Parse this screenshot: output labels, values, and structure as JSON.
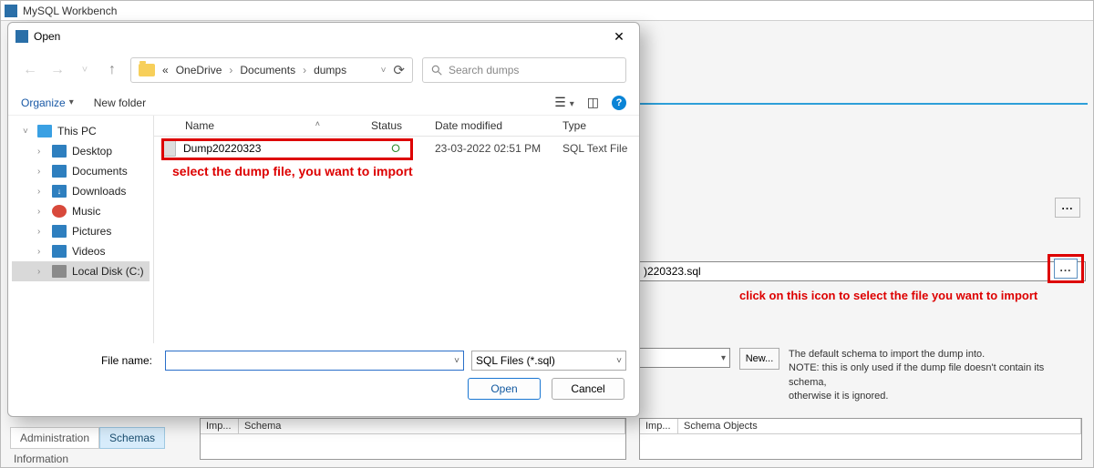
{
  "workbench": {
    "title": "MySQL Workbench",
    "nav_admin": "Administration",
    "nav_schemas": "Schemas",
    "nav_info": "Information"
  },
  "content": {
    "path_visible": ")220323.sql",
    "new_btn": "New...",
    "schema_note_l1": "The default schema to import the dump into.",
    "schema_note_l2": "NOTE: this is only used if the dump file doesn't contain its schema,",
    "schema_note_l3": "otherwise it is ignored.",
    "grid_left_h1": "Imp...",
    "grid_left_h2": "Schema",
    "grid_right_h1": "Imp...",
    "grid_right_h2": "Schema Objects"
  },
  "annotations": {
    "sel_file": "select the dump file, you want to import",
    "click_icon": "click on this icon to select the file you want to import"
  },
  "dialog": {
    "title": "Open",
    "breadcrumb": {
      "pre": "«",
      "p1": "OneDrive",
      "p2": "Documents",
      "p3": "dumps"
    },
    "search_placeholder": "Search dumps",
    "organize": "Organize",
    "new_folder": "New folder",
    "headers": {
      "name": "Name",
      "status": "Status",
      "date": "Date modified",
      "type": "Type"
    },
    "tree": {
      "this_pc": "This PC",
      "desktop": "Desktop",
      "documents": "Documents",
      "downloads": "Downloads",
      "music": "Music",
      "pictures": "Pictures",
      "videos": "Videos",
      "local_disk": "Local Disk (C:)"
    },
    "file": {
      "name": "Dump20220323",
      "date": "23-03-2022 02:51 PM",
      "type": "SQL Text File"
    },
    "filename_label": "File name:",
    "filetype": "SQL Files (*.sql)",
    "open": "Open",
    "cancel": "Cancel"
  }
}
